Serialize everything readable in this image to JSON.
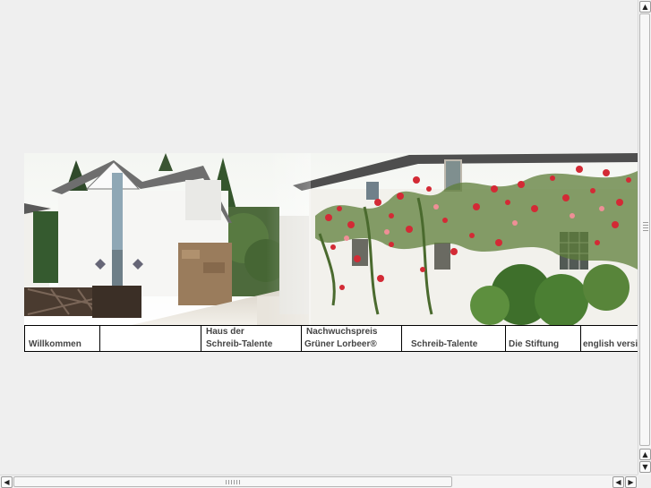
{
  "banner": {
    "description_icon": "house-roses-photo"
  },
  "nav": {
    "items": [
      {
        "label_line1": "",
        "label_line2": "Willkommen"
      },
      {
        "label_line1": "",
        "label_line2": ""
      },
      {
        "label_line1": "Haus der",
        "label_line2": "Schreib-Talente"
      },
      {
        "label_line1": "Nachwuchspreis",
        "label_line2": "Grüner Lorbeer®"
      },
      {
        "label_line1": "",
        "label_line2": "Schreib-Talente"
      },
      {
        "label_line1": "",
        "label_line2": "Die Stiftung"
      },
      {
        "label_line1": "",
        "label_line2": "english version"
      }
    ]
  },
  "scrollbars": {
    "up_icon": "▲",
    "down_icon": "▼",
    "left_icon": "◀",
    "right_icon": "▶"
  }
}
